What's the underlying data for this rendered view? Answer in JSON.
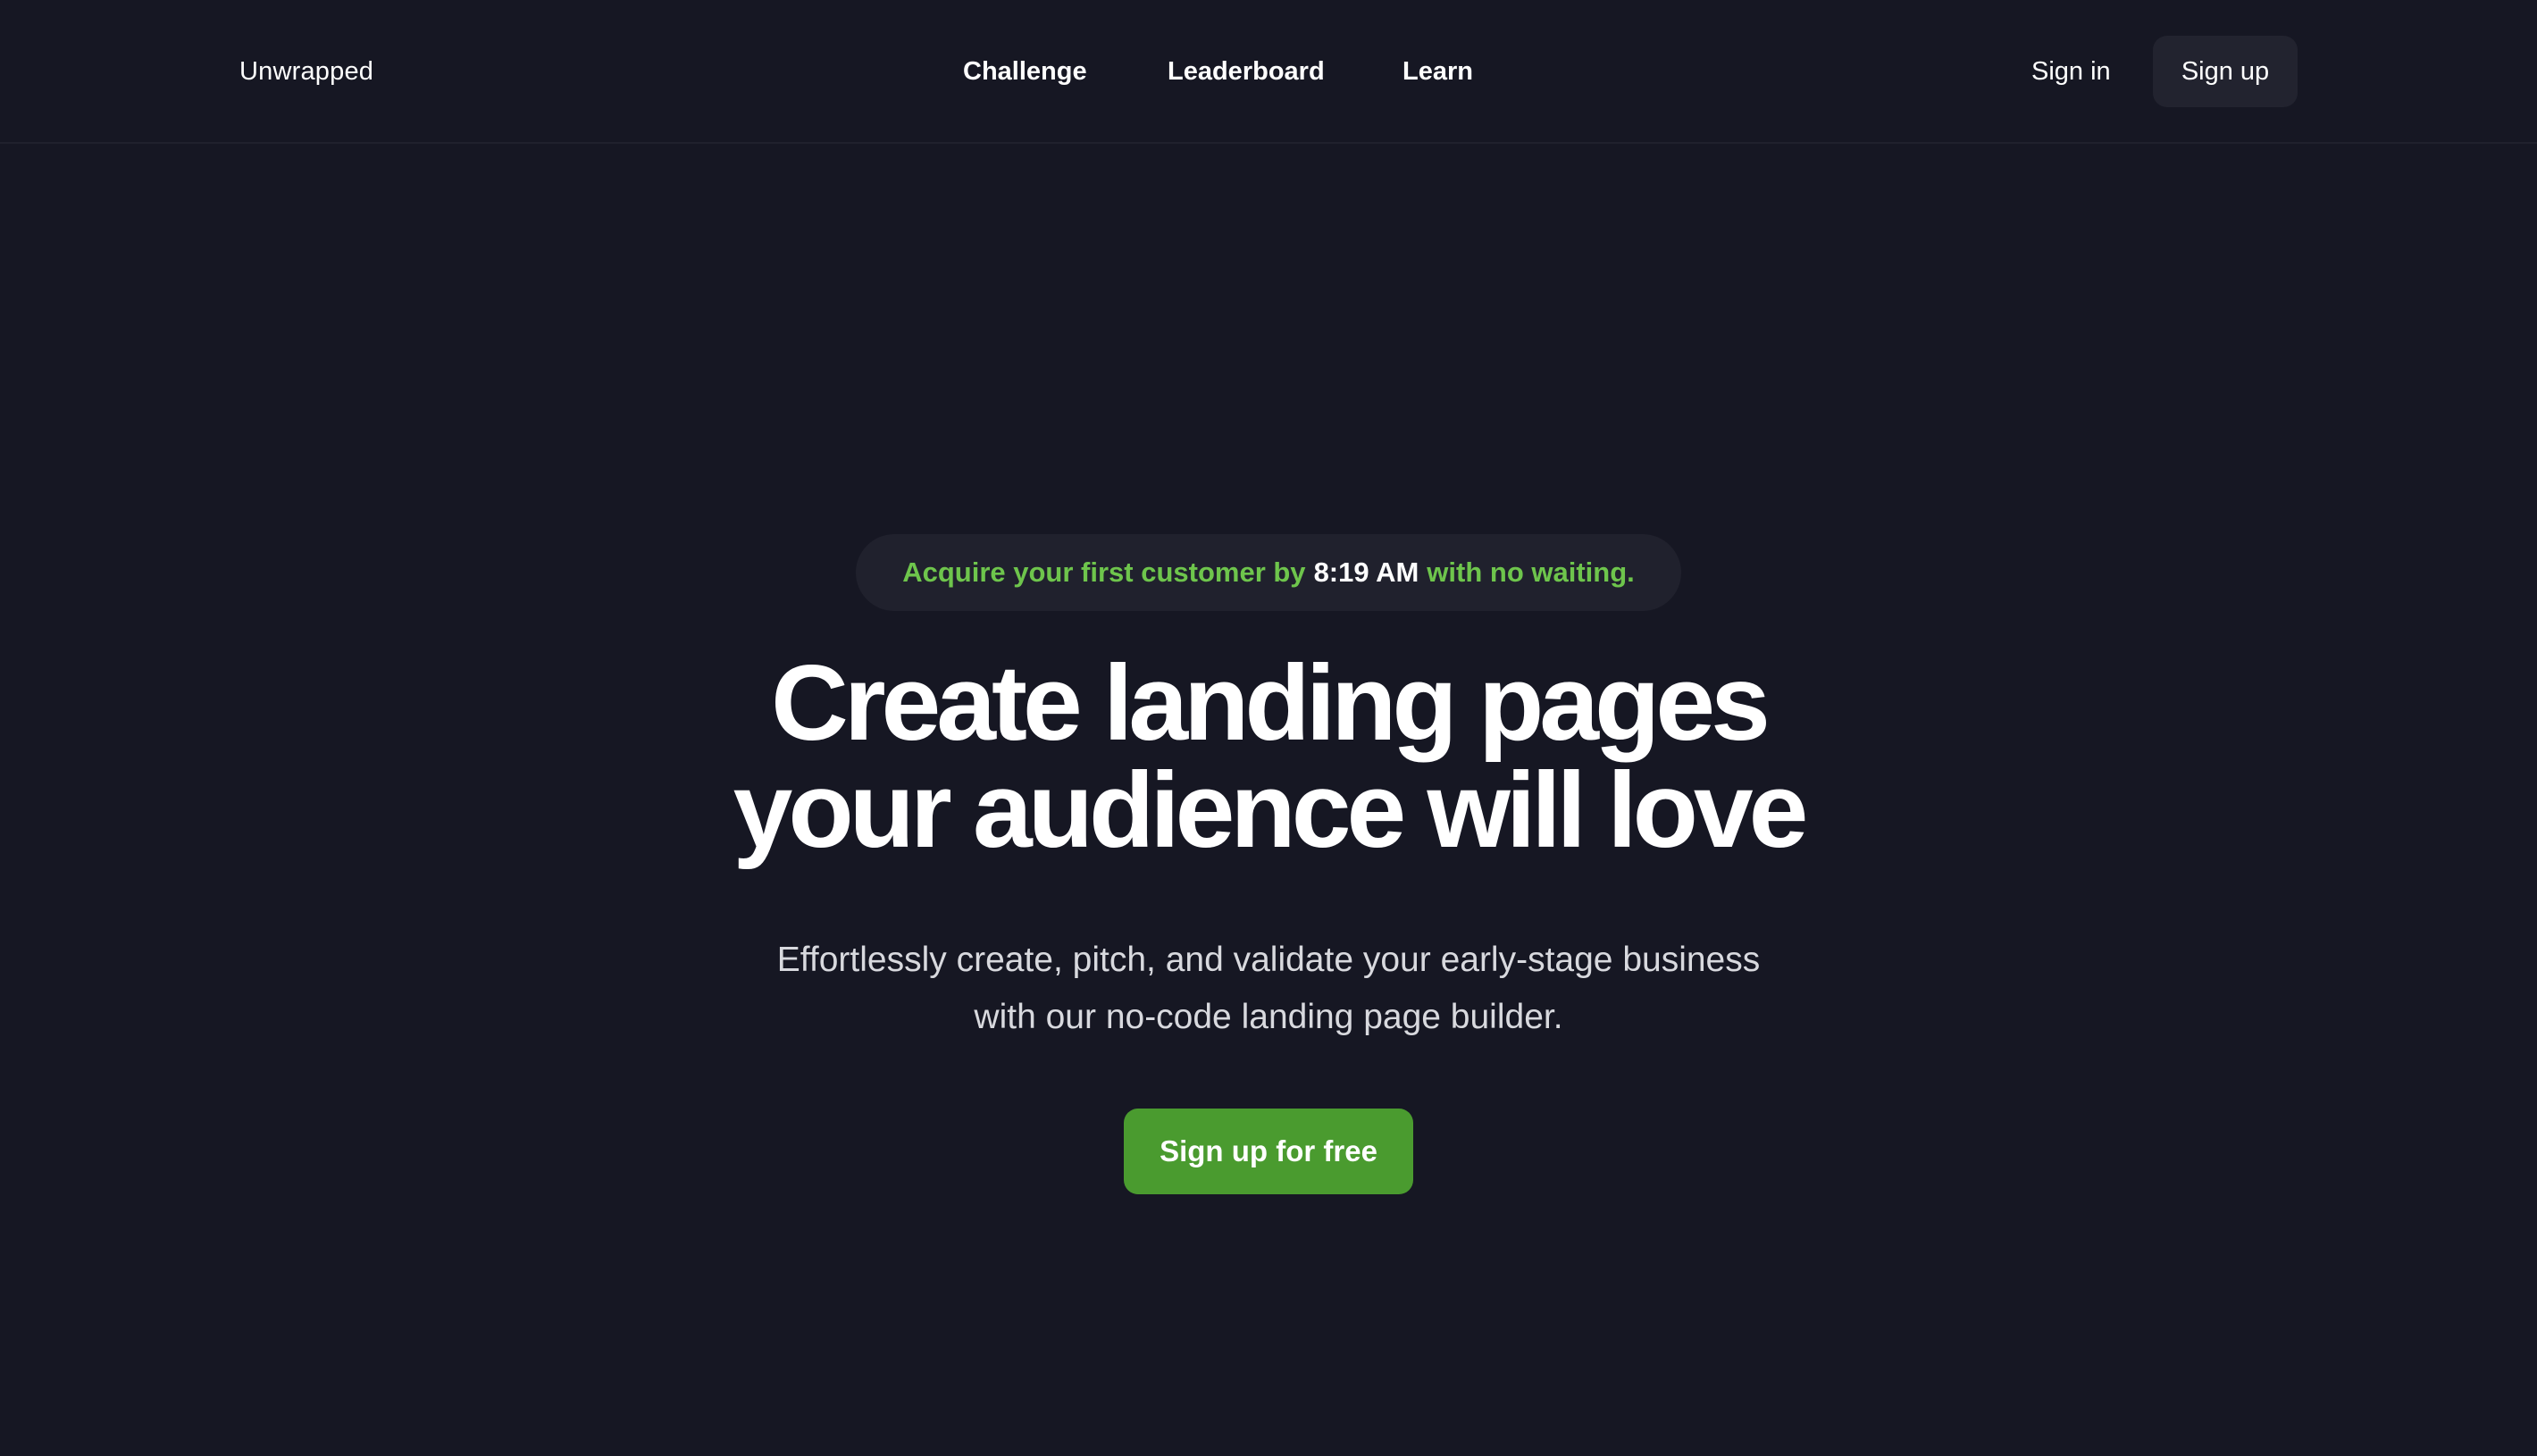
{
  "header": {
    "brand": "Unwrapped",
    "nav": [
      {
        "label": "Challenge"
      },
      {
        "label": "Leaderboard"
      },
      {
        "label": "Learn"
      }
    ],
    "sign_in": "Sign in",
    "sign_up": "Sign up"
  },
  "hero": {
    "badge": {
      "prefix": "Acquire your first customer by",
      "time": "8:19 AM",
      "suffix": "with no waiting."
    },
    "headline_line1": "Create landing pages",
    "headline_line2": "your audience will love",
    "subtext_line1": "Effortlessly create, pitch, and validate your early-stage business",
    "subtext_line2": "with our no-code landing page builder.",
    "cta": "Sign up for free"
  },
  "colors": {
    "background": "#161723",
    "accent_green": "#6ec54c",
    "cta_green": "#4a9b2f",
    "surface": "#22232f"
  }
}
